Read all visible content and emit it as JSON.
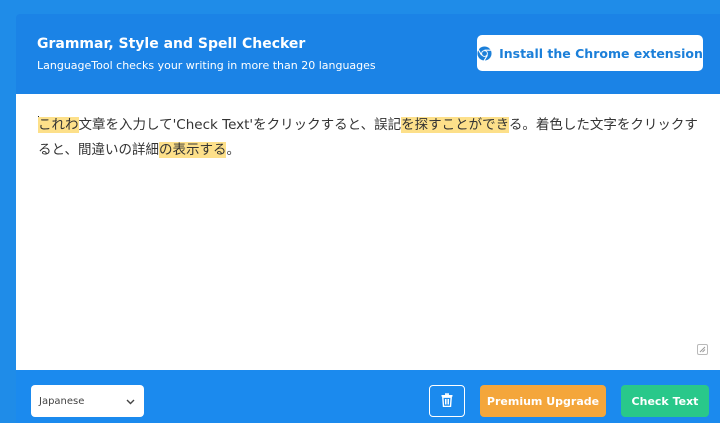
{
  "header": {
    "title": "Grammar, Style and Spell Checker",
    "subtitle": "LanguageTool checks your writing in more than 20 languages",
    "chrome_button_label": "Install the Chrome extension",
    "chrome_icon": "chrome-icon"
  },
  "editor": {
    "segments": [
      {
        "text": "これわ",
        "highlighted": true
      },
      {
        "text": "文章を入力して'Check Text'をクリックすると、誤記",
        "highlighted": false
      },
      {
        "text": "を探すことができ",
        "highlighted": true
      },
      {
        "text": "る。着色した文字をクリックすると、間違いの詳細",
        "highlighted": false
      },
      {
        "text": "の表示する",
        "highlighted": true
      },
      {
        "text": "。",
        "highlighted": false
      }
    ]
  },
  "footer": {
    "language_selected": "Japanese",
    "premium_label": "Premium Upgrade",
    "check_label": "Check Text"
  },
  "colors": {
    "background": "#1f8ce8",
    "header": "#1b83e6",
    "highlight": "#fde08a",
    "premium": "#f4a63b",
    "check": "#29c88a"
  }
}
